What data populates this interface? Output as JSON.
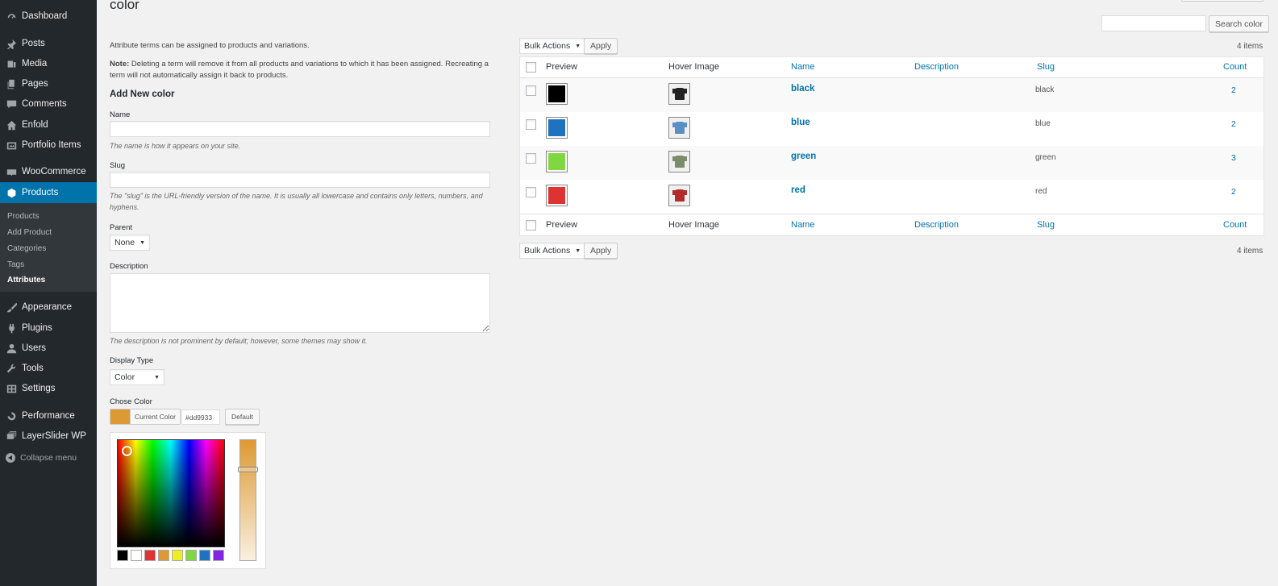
{
  "page": {
    "title": "color",
    "search_button": "Search color",
    "items_count": "4 items"
  },
  "sidebar": {
    "items": [
      {
        "label": "Dashboard",
        "icon": "dashboard-icon"
      },
      {
        "label": "Posts",
        "icon": "pin-icon"
      },
      {
        "label": "Media",
        "icon": "media-icon"
      },
      {
        "label": "Pages",
        "icon": "pages-icon"
      },
      {
        "label": "Comments",
        "icon": "comment-icon"
      },
      {
        "label": "Enfold",
        "icon": "home-icon"
      },
      {
        "label": "Portfolio Items",
        "icon": "portfolio-icon"
      },
      {
        "label": "WooCommerce",
        "icon": "woo-icon"
      },
      {
        "label": "Products",
        "icon": "products-icon"
      },
      {
        "label": "Appearance",
        "icon": "brush-icon"
      },
      {
        "label": "Plugins",
        "icon": "plug-icon"
      },
      {
        "label": "Users",
        "icon": "user-icon"
      },
      {
        "label": "Tools",
        "icon": "wrench-icon"
      },
      {
        "label": "Settings",
        "icon": "settings-icon"
      },
      {
        "label": "Performance",
        "icon": "performance-icon"
      },
      {
        "label": "LayerSlider WP",
        "icon": "layers-icon"
      }
    ],
    "submenu": [
      "Products",
      "Add Product",
      "Categories",
      "Tags",
      "Attributes"
    ],
    "collapse_label": "Collapse menu"
  },
  "form": {
    "intro": "Attribute terms can be assigned to products and variations.",
    "note_label": "Note:",
    "note_text": " Deleting a term will remove it from all products and variations to which it has been assigned. Recreating a term will not automatically assign it back to products.",
    "heading": "Add New color",
    "name_label": "Name",
    "name_hint": "The name is how it appears on your site.",
    "slug_label": "Slug",
    "slug_hint": "The \"slug\" is the URL-friendly version of the name. It is usually all lowercase and contains only letters, numbers, and hyphens.",
    "parent_label": "Parent",
    "parent_value": "None",
    "description_label": "Description",
    "description_hint": "The description is not prominent by default; however, some themes may show it.",
    "display_type_label": "Display Type",
    "display_type_value": "Color",
    "chose_color_label": "Chose Color",
    "current_color_label": "Current Color",
    "current_color_value": "#dd9933",
    "current_color": "#dd9933",
    "default_button": "Default",
    "palette": [
      "#000000",
      "#ffffff",
      "#dd3333",
      "#dd9933",
      "#eeee22",
      "#81d742",
      "#1e73be",
      "#8224e3"
    ]
  },
  "table": {
    "bulk_actions": "Bulk Actions",
    "apply": "Apply",
    "columns": {
      "preview": "Preview",
      "hover_image": "Hover Image",
      "name": "Name",
      "description": "Description",
      "slug": "Slug",
      "count": "Count"
    },
    "rows": [
      {
        "name": "black",
        "slug": "black",
        "count": "2",
        "color": "#000000",
        "shirt_color": "#222222"
      },
      {
        "name": "blue",
        "slug": "blue",
        "count": "2",
        "color": "#1e73be",
        "shirt_color": "#5b8fc4"
      },
      {
        "name": "green",
        "slug": "green",
        "count": "3",
        "color": "#81d742",
        "shirt_color": "#7c8c68"
      },
      {
        "name": "red",
        "slug": "red",
        "count": "2",
        "color": "#dd3333",
        "shirt_color": "#b22a2a"
      }
    ]
  }
}
